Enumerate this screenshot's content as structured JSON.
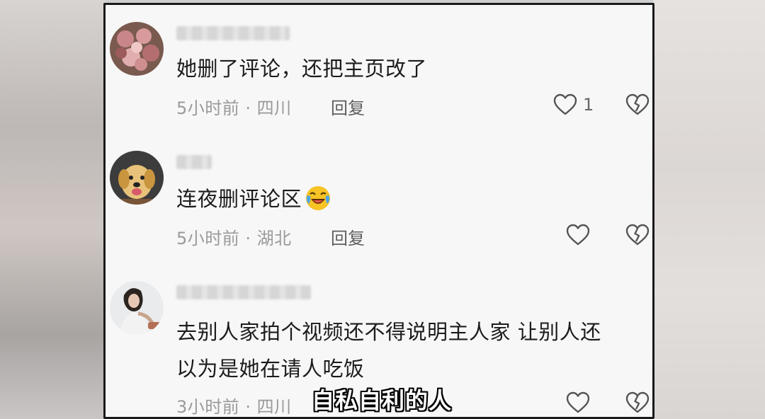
{
  "comments": [
    {
      "text": "她删了评论，还把主页改了",
      "meta": "5小时前 · 四川",
      "reply_label": "回复",
      "like_count": "1"
    },
    {
      "text": "连夜删评论区",
      "meta": "5小时前 · 湖北",
      "reply_label": "回复",
      "like_count": ""
    },
    {
      "text_line1": "去别人家拍个视频还不得说明主人家 让别人还",
      "text_line2": "以为是她在请人吃饭",
      "meta": "3小时前 · 四川",
      "reply_label": "回复",
      "like_count": ""
    }
  ],
  "subtitle": "自私自利的人",
  "icons": {
    "like": "heart-outline-icon",
    "dislike": "broken-heart-icon",
    "emoji": "laughing-crying-emoji-icon"
  },
  "colors": {
    "frame_border": "#1a1a1a",
    "card_background": "#f7f7f7",
    "text": "#1c1c1c",
    "meta": "#9a9a9a"
  }
}
